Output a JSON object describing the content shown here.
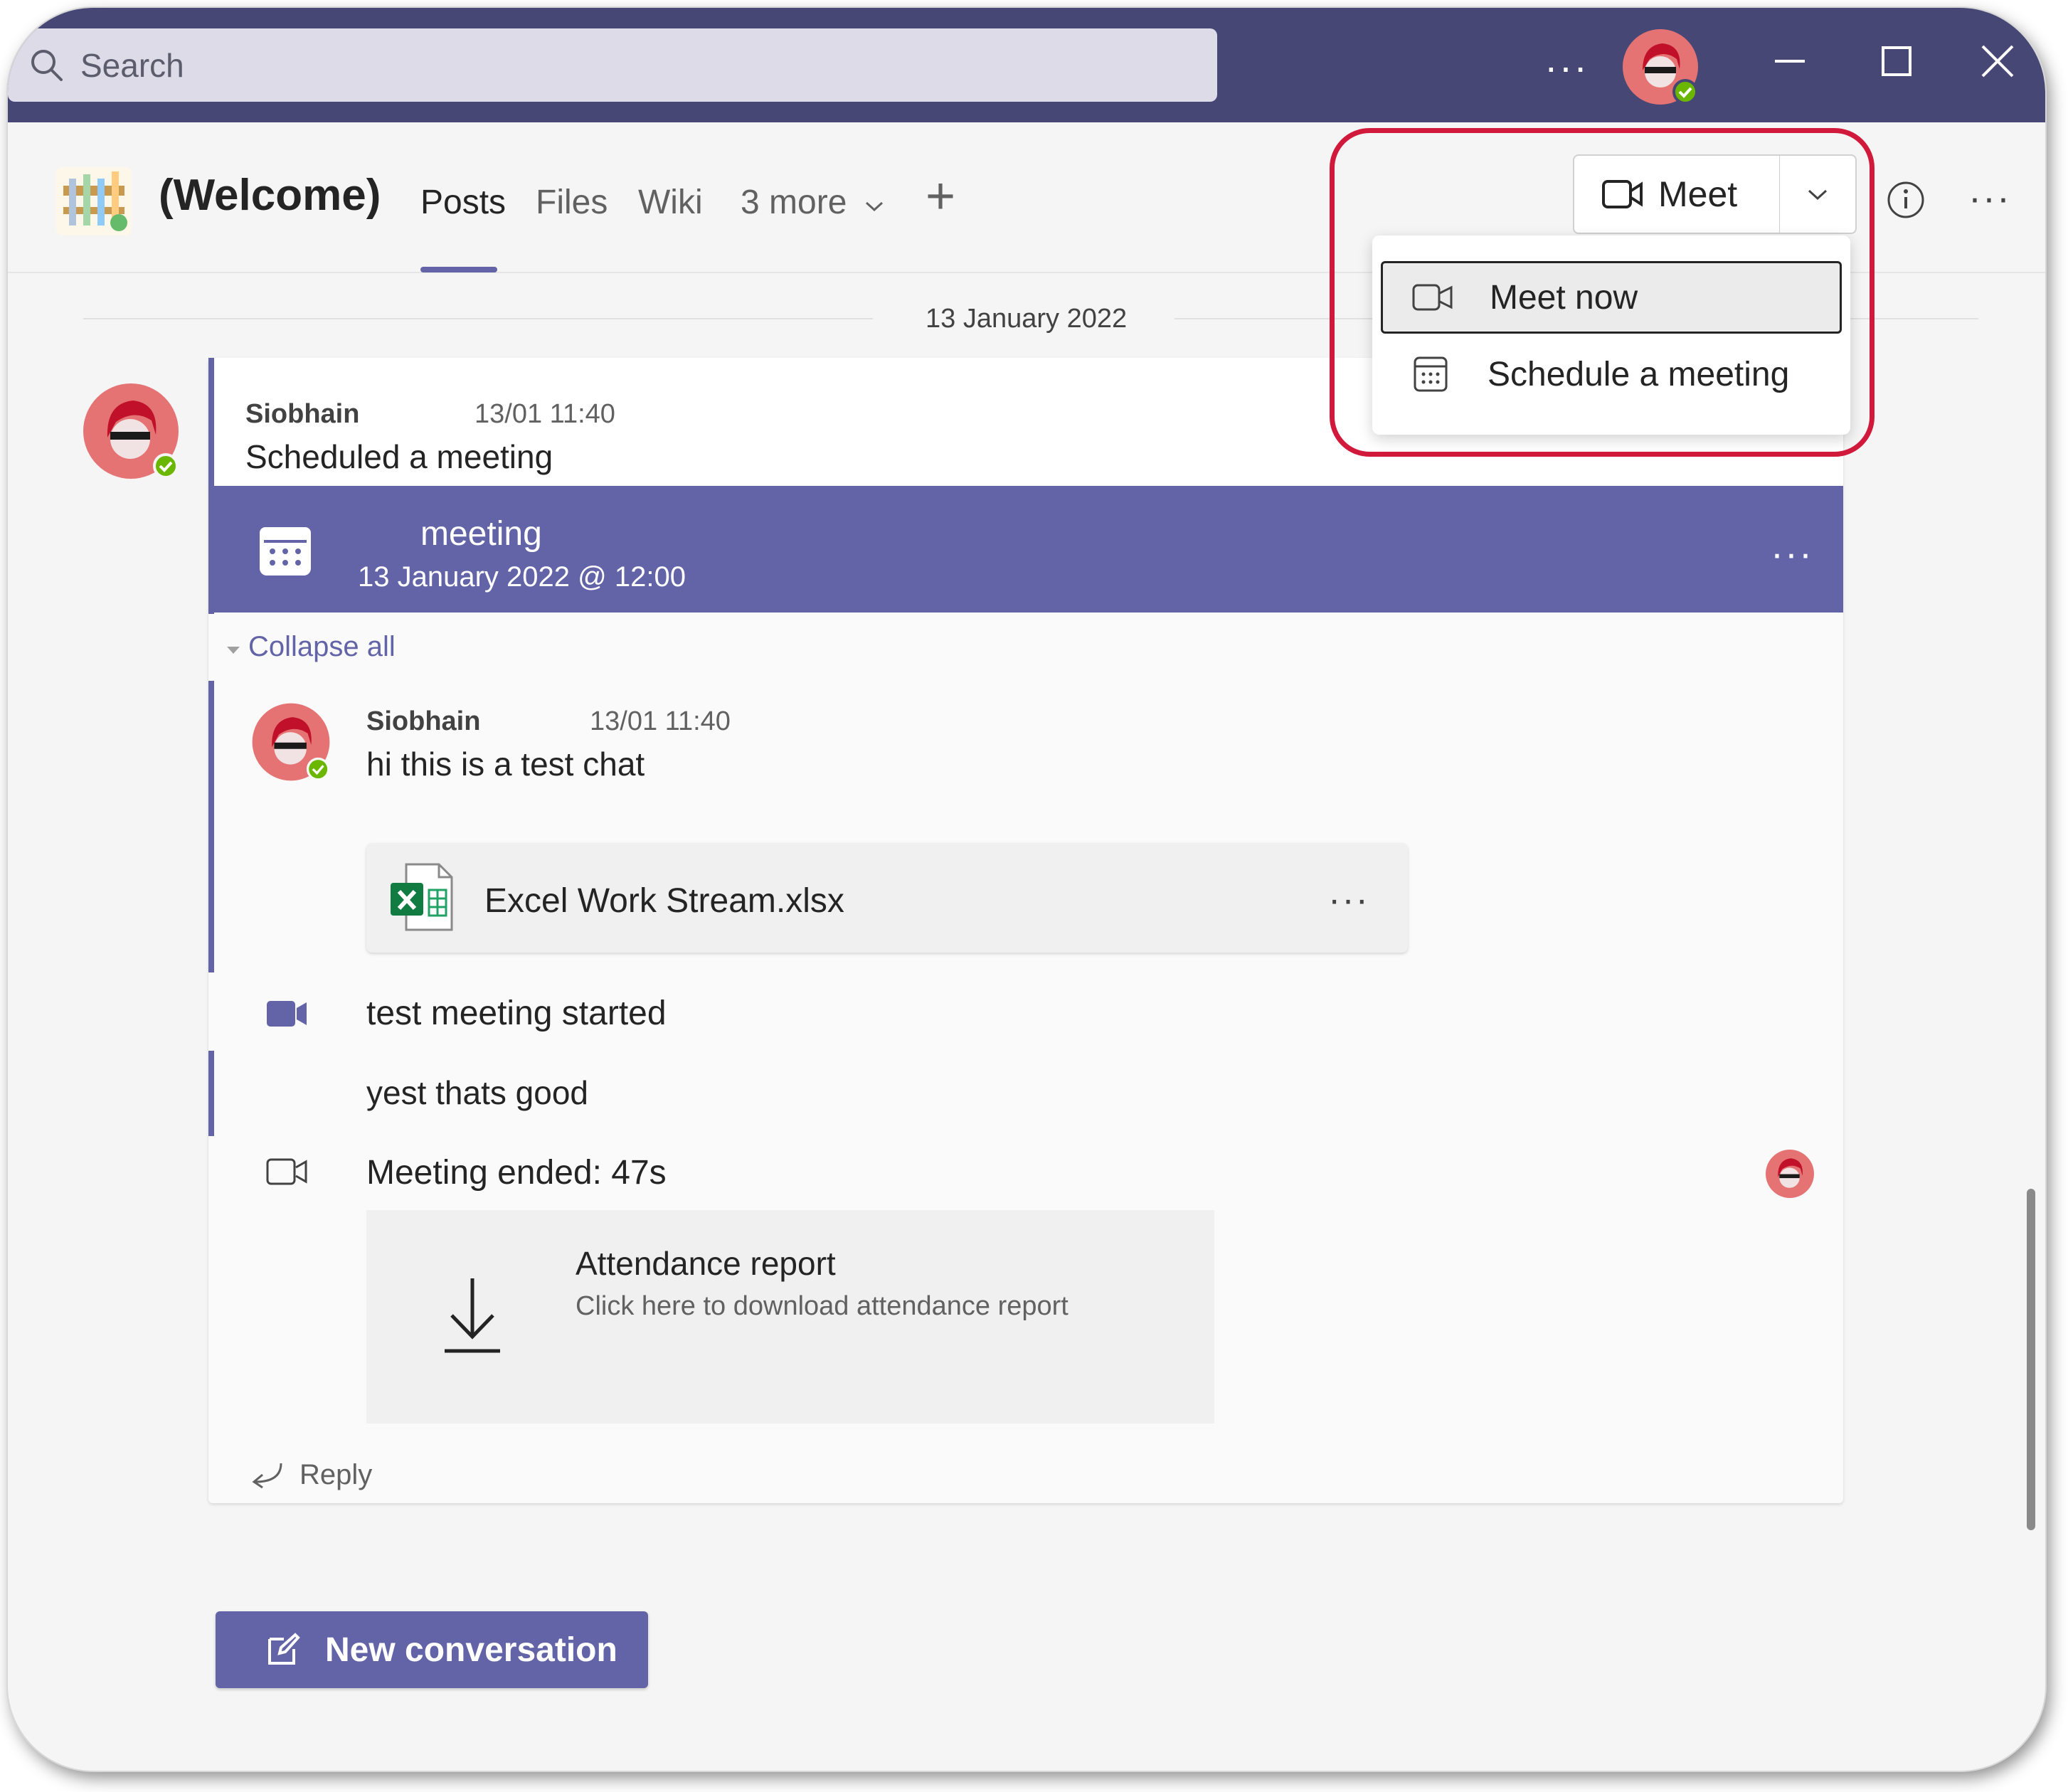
{
  "titlebar": {
    "search_placeholder": "Search",
    "more_label": "···"
  },
  "header": {
    "channel_title": "(Welcome)",
    "tabs": [
      {
        "label": "Posts"
      },
      {
        "label": "Files"
      },
      {
        "label": "Wiki"
      },
      {
        "label": "3 more"
      }
    ],
    "add_tab": "+",
    "meet_label": "Meet",
    "more_label": "···"
  },
  "meet_menu": {
    "items": [
      {
        "label": "Meet now",
        "icon": "video-camera-icon"
      },
      {
        "label": "Schedule a meeting",
        "icon": "calendar-icon"
      }
    ]
  },
  "feed": {
    "date_divider": "13 January 2022",
    "post": {
      "author": "Siobhain",
      "time": "13/01 11:40",
      "text": "Scheduled a meeting"
    },
    "meeting_banner": {
      "title": "meeting",
      "date": "13 January 2022 @ 12:00",
      "more": "···"
    },
    "collapse_all": "Collapse all",
    "reply_message": {
      "author": "Siobhain",
      "time": "13/01 11:40",
      "text": "hi this is a test chat"
    },
    "attachment": {
      "file_name": "Excel Work Stream.xlsx",
      "more": "···"
    },
    "meeting_started": "test meeting started",
    "message2": "yest thats good",
    "meeting_ended": "Meeting ended: 47s",
    "attendance": {
      "title": "Attendance report",
      "subtitle": "Click here to download attendance report"
    },
    "reply_label": "Reply"
  },
  "footer": {
    "new_conversation": "New conversation"
  },
  "colors": {
    "titlebar": "#464775",
    "accent": "#6264a7",
    "highlight": "#d0193b",
    "presence": "#6bb700"
  }
}
